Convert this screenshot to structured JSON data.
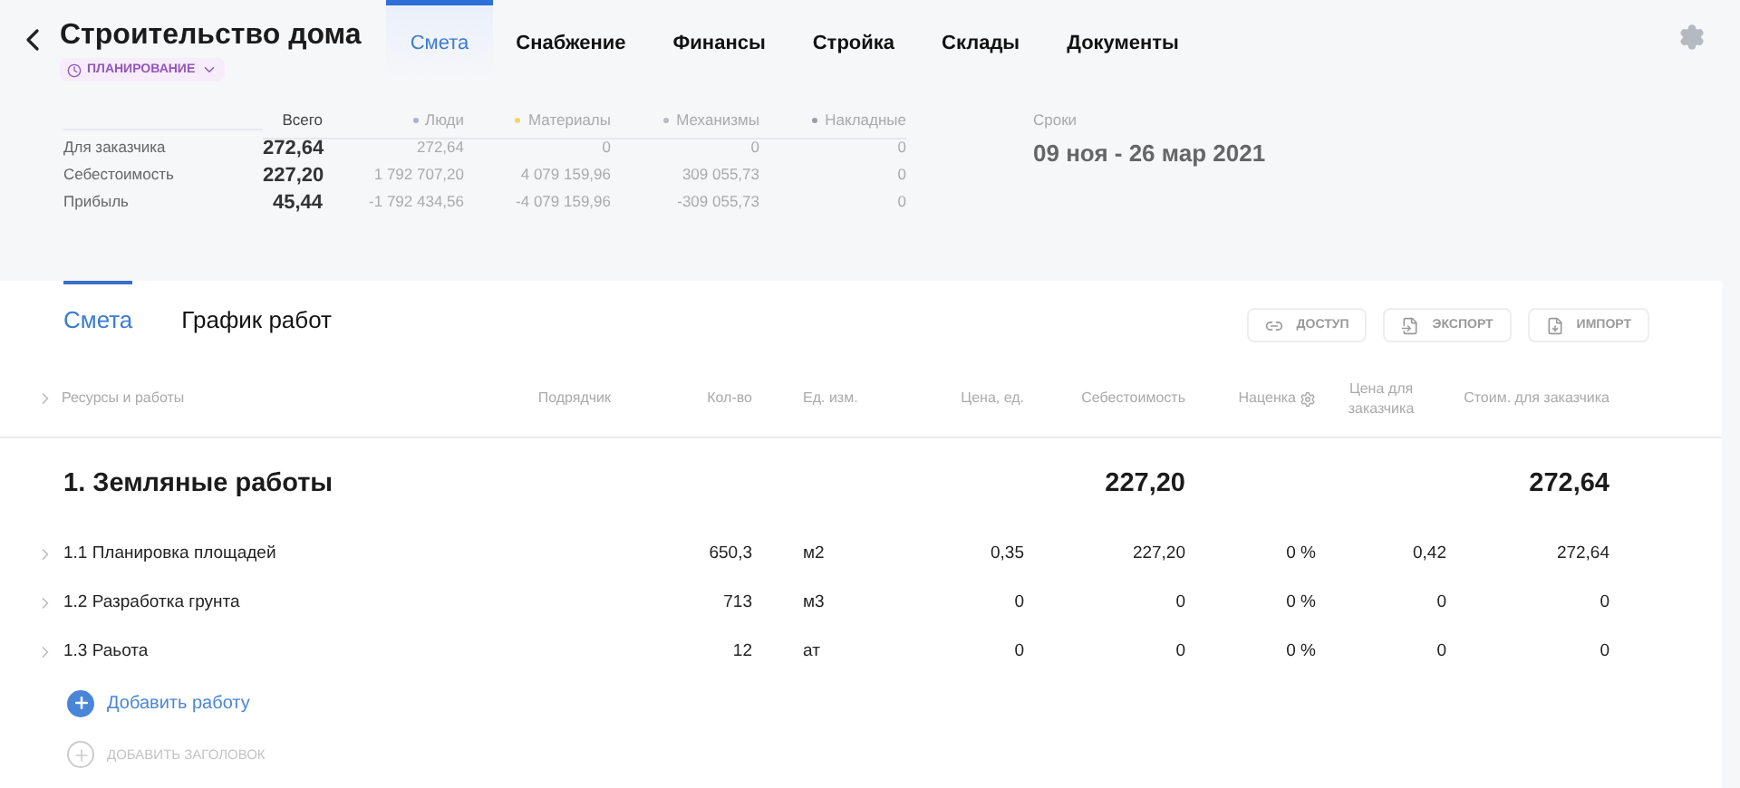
{
  "header": {
    "title": "Строительство дома",
    "status": "ПЛАНИРОВАНИЕ"
  },
  "nav_tabs": [
    {
      "label": "Смета",
      "selected": true
    },
    {
      "label": "Снабжение",
      "selected": false
    },
    {
      "label": "Финансы",
      "selected": false
    },
    {
      "label": "Стройка",
      "selected": false
    },
    {
      "label": "Склады",
      "selected": false
    },
    {
      "label": "Документы",
      "selected": false
    }
  ],
  "summary": {
    "columns": [
      {
        "label": "Всего"
      },
      {
        "label": "Люди",
        "color": "#a9b4c8"
      },
      {
        "label": "Материалы",
        "color": "#f2d36b"
      },
      {
        "label": "Механизмы",
        "color": "#b8bcc4"
      },
      {
        "label": "Накладные",
        "color": "#9aa0a8"
      }
    ],
    "rows": [
      {
        "label": "Для заказчика",
        "cells": [
          "272,64",
          "272,64",
          "0",
          "0",
          "0"
        ]
      },
      {
        "label": "Себестоимость",
        "cells": [
          "227,20",
          "1 792 707,20",
          "4 079 159,96",
          "309 055,73",
          "0"
        ]
      },
      {
        "label": "Прибыль",
        "cells": [
          "45,44",
          "-1 792 434,56",
          "-4 079 159,96",
          "-309 055,73",
          "0"
        ]
      }
    ]
  },
  "terms": {
    "label": "Сроки",
    "value": "09 ноя - 26 мар 2021"
  },
  "sub_tabs": [
    {
      "label": "Смета",
      "selected": true
    },
    {
      "label": "График работ",
      "selected": false
    }
  ],
  "actions": [
    {
      "label": "ДОСТУП",
      "kind": "link"
    },
    {
      "label": "ЭКСПОРТ",
      "kind": "export"
    },
    {
      "label": "ИМПОРТ",
      "kind": "import"
    }
  ],
  "table": {
    "columns": [
      "Ресурсы и работы",
      "Подрядчик",
      "Кол-во",
      "Ед. изм.",
      "Цена, ед.",
      "Себестоимость",
      "Наценка",
      "Цена для заказчика",
      "Стоим. для заказчика"
    ],
    "sections": [
      {
        "title": "1. Земляные работы",
        "cost": "227,20",
        "total": "272,64",
        "rows": [
          {
            "name": "1.1 Планировка площадей",
            "contractor": "",
            "qty": "650,3",
            "unit": "м2",
            "price": "0,35",
            "cost": "227,20",
            "markup": "0 %",
            "client_price": "0,42",
            "total": "272,64"
          },
          {
            "name": "1.2 Разработка грунта",
            "contractor": "",
            "qty": "713",
            "unit": "м3",
            "price": "0",
            "cost": "0",
            "markup": "0 %",
            "client_price": "0",
            "total": "0"
          },
          {
            "name": "1.3 Раьота",
            "contractor": "",
            "qty": "12",
            "unit": "ат",
            "price": "0",
            "cost": "0",
            "markup": "0 %",
            "client_price": "0",
            "total": "0"
          }
        ]
      }
    ],
    "add_work": "Добавить работу",
    "add_heading": "ДОБАВИТЬ ЗАГОЛОВОК"
  }
}
